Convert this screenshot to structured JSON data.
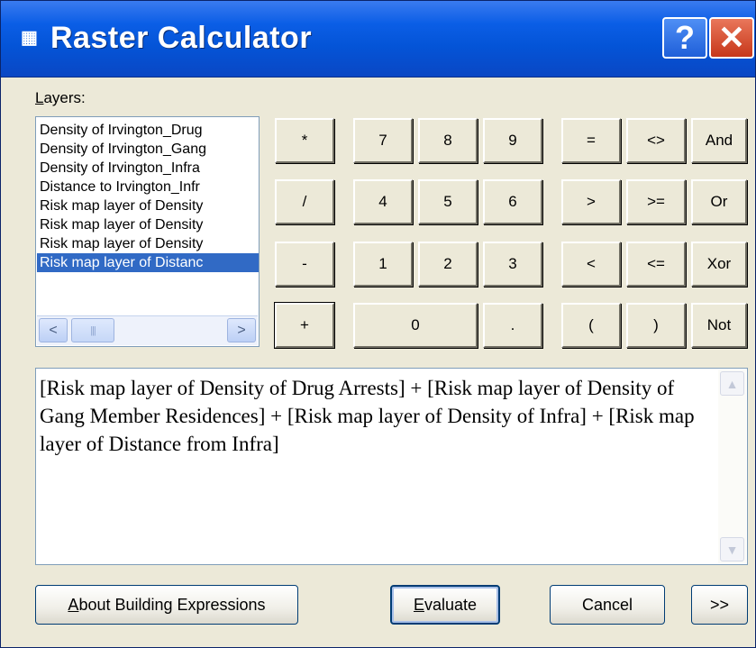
{
  "window": {
    "title": "Raster Calculator",
    "help_glyph": "?",
    "close_glyph": "✕",
    "title_icon": "calculator-grid-icon"
  },
  "layers": {
    "label": "Layers:",
    "items": [
      "Density of Irvington_Drug",
      "Density of Irvington_Gang",
      "Density of Irvington_Infra",
      "Distance to Irvington_Infr",
      "Risk map layer of Density",
      "Risk map layer of Density",
      "Risk map layer of Density",
      "Risk map layer of Distanc"
    ],
    "selected_index": 7,
    "scroll_left_glyph": "<",
    "scroll_right_glyph": ">",
    "thumb_grip": "|||"
  },
  "keypad": {
    "multiply": "*",
    "seven": "7",
    "eight": "8",
    "nine": "9",
    "equals": "=",
    "not_equal": "<>",
    "and": "And",
    "divide": "/",
    "four": "4",
    "five": "5",
    "six": "6",
    "greater": ">",
    "greater_equal": ">=",
    "or": "Or",
    "minus": "-",
    "one": "1",
    "two": "2",
    "three": "3",
    "less": "<",
    "less_equal": "<=",
    "xor": "Xor",
    "plus": "+",
    "zero": "0",
    "decimal": ".",
    "open_paren": "(",
    "close_paren": ")",
    "not": "Not"
  },
  "expression": {
    "text": "[Risk map layer of Density of Drug Arrests] + [Risk map layer of Density of Gang Member Residences] + [Risk map layer of Density of Infra] + [Risk map layer of Distance from Infra]",
    "scroll_up_glyph": "▲",
    "scroll_down_glyph": "▼"
  },
  "buttons": {
    "about": "About Building Expressions",
    "evaluate": "Evaluate",
    "cancel": "Cancel",
    "more": ">>"
  },
  "background_fragment": "a",
  "colors": {
    "title_bar": "#0454d7",
    "dialog_face": "#ece9d8",
    "selection": "#316ac5",
    "close_button": "#c7371a"
  }
}
